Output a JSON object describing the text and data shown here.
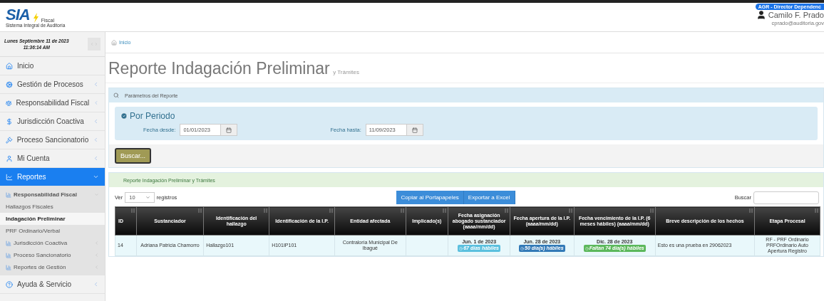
{
  "logo": {
    "mark": "SIA",
    "product": "Fiscal",
    "subtitle": "Sistema Integral de Auditoría"
  },
  "user": {
    "role": "AGR - Director Dependenc",
    "name": "Camilo F. Prado",
    "email": "cprado@auditoria.gov"
  },
  "clock": {
    "date": "Lunes Septiembre 11 de 2023",
    "time": "11:36:14 AM"
  },
  "sidebar": {
    "items": [
      {
        "label": "Inicio",
        "selected": false
      },
      {
        "label": "Gestión de Procesos",
        "expanded": false,
        "selected": false
      },
      {
        "label": "Responsabilidad Fiscal",
        "expanded": false,
        "selected": false
      },
      {
        "label": "Jurisdicción Coactiva",
        "expanded": false,
        "selected": false
      },
      {
        "label": "Proceso Sancionatorio",
        "expanded": false,
        "selected": false
      },
      {
        "label": "Mi Cuenta",
        "expanded": false,
        "selected": false
      },
      {
        "label": "Reportes",
        "expanded": true,
        "selected": true,
        "children": [
          {
            "label": "Responsabilidad Fiscal",
            "expanded": true,
            "children": [
              {
                "label": "Hallazgos Fiscales",
                "selected": false
              },
              {
                "label": "Indagación Preliminar",
                "selected": true
              },
              {
                "label": "PRF Ordinario/Verbal",
                "selected": false
              }
            ]
          },
          {
            "label": "Jurisdicción Coactiva",
            "expanded": false
          },
          {
            "label": "Proceso Sancionatorio",
            "expanded": false
          },
          {
            "label": "Reportes de Gestión",
            "expanded": false
          }
        ]
      },
      {
        "label": "Ayuda & Servicio",
        "expanded": false,
        "selected": false
      }
    ]
  },
  "breadcrumb": [
    "Inicio"
  ],
  "page_title": {
    "main": "Reporte Indagación Preliminar",
    "suffix": "y Trámites"
  },
  "parameters": {
    "title": "Parámetros del Reporte",
    "section": "Por Periodo",
    "fields": [
      {
        "label": "Fecha desde:",
        "value": "01/01/2023"
      },
      {
        "label": "Fecha hasta:",
        "value": "11/09/2023"
      }
    ],
    "button": "Buscar..."
  },
  "report": {
    "title": "Reporte Indagación Preliminar y Trámites",
    "show_label": "Ver",
    "page_size": "10",
    "records_label": "registros",
    "buttons": [
      "Copiar al Portapapeles",
      "Exportar a Excel"
    ],
    "search_label": "Buscar",
    "columns": [
      "ID",
      "Sustanciador",
      "Identificación del hallazgo",
      "Identificación de la I.P.",
      "Entidad afectada",
      "Implicado(s)",
      "Fecha asignación abogado sustanciador (aaaa/mm/dd)",
      "Fecha apertura de la I.P. (aaaa/mm/dd)",
      "Fecha vencimiento de la I.P. (6 meses hábiles) (aaaa/mm/dd)",
      "Breve descripción de los hechos",
      "Etapa Procesal"
    ],
    "rows": [
      {
        "cells": [
          "14",
          "Adriana Patricia Chamorro",
          "Hallazgo101",
          "H101IP101",
          "Contraloría Municipal De Ibagué",
          "",
          {
            "date": "Jun. 1 de 2023",
            "badge": "67 días hábiles",
            "color": "#5bc0de"
          },
          {
            "date": "Jun. 28 de 2023",
            "badge": "50 día(s) hábiles",
            "color": "#337ab7"
          },
          {
            "date": "Dic. 28 de 2023",
            "badge": "Faltan 74 día(s) hábiles",
            "color": "#5cb85c"
          },
          "Esto es una prueba en 29062023",
          "RF - PRF Ordinario PRFOrdinario Auto Apertura Registro"
        ]
      }
    ]
  }
}
